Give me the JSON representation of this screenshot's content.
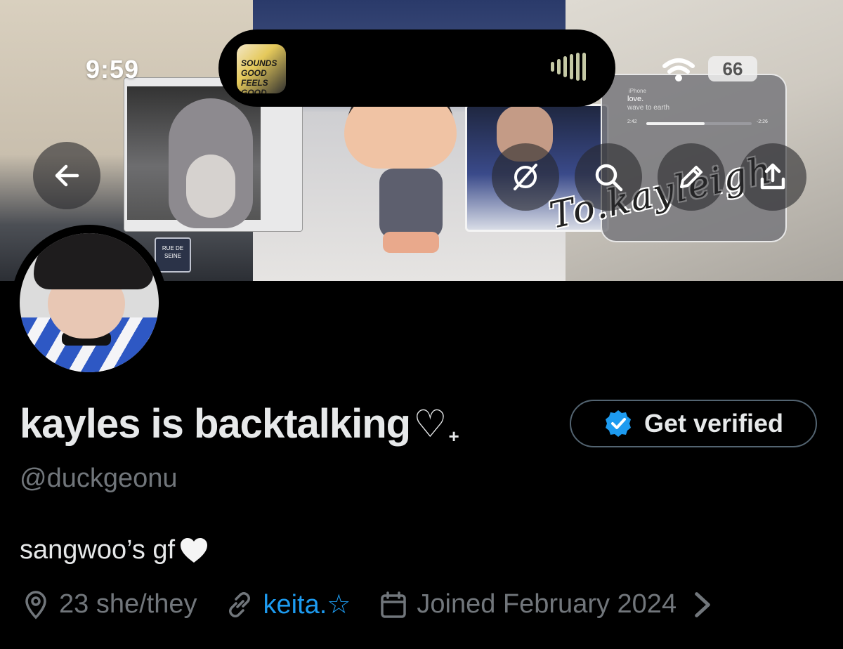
{
  "status_bar": {
    "time": "9:59",
    "battery": "66",
    "now_playing_art_text": "SOUNDS GOOD FEELS GOOD"
  },
  "banner": {
    "signature": "To.kayleigh",
    "street_sign": "RUE DE SEINE",
    "music_widget": {
      "source": "iPhone",
      "title": "love.",
      "artist": "wave to earth",
      "elapsed": "2:42",
      "remaining": "-2:26",
      "progress": 0.55
    }
  },
  "profile": {
    "display_name": "kayles is backtalking",
    "name_heart": "♡",
    "name_suffix": "+",
    "handle": "@duckgeonu",
    "bio": "sangwoo’s gf",
    "get_verified_label": "Get verified",
    "location": "23 she/they",
    "website": "keita.☆",
    "joined": "Joined February 2024"
  },
  "icons": {
    "back": "arrow-left-icon",
    "grok": "grok-icon",
    "search": "search-icon",
    "edit": "pencil-icon",
    "share": "share-icon",
    "location": "location-pin-icon",
    "link": "link-icon",
    "calendar": "calendar-icon"
  },
  "colors": {
    "background": "#000000",
    "text_primary": "#e7e9ea",
    "text_secondary": "#71767b",
    "link": "#1d9bf0",
    "verified_badge": "#1d9bf0"
  }
}
